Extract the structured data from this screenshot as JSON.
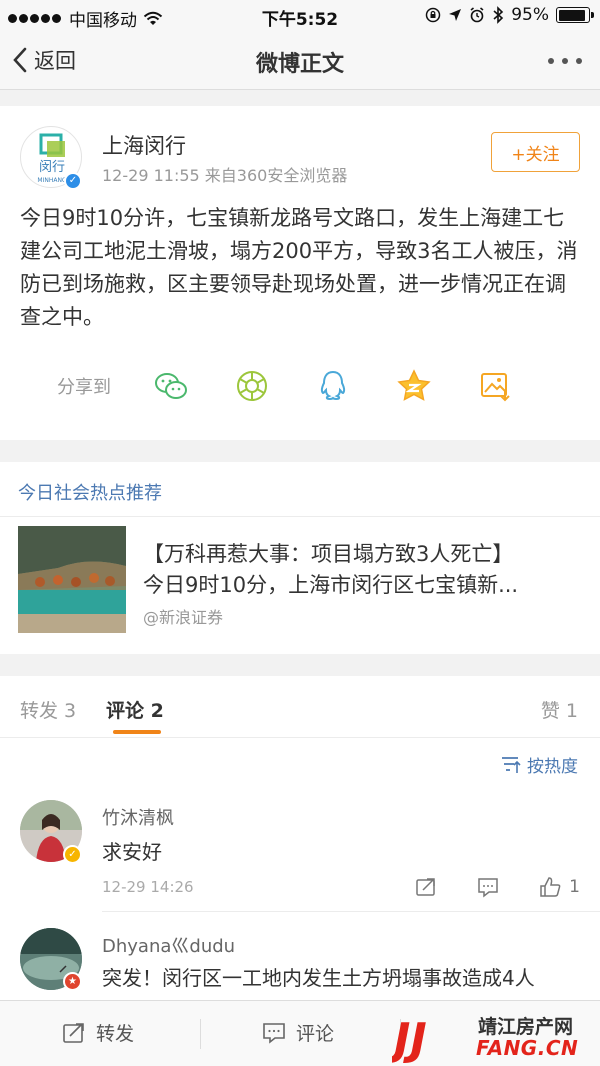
{
  "status_bar": {
    "carrier": "中国移动",
    "time": "下午5:52",
    "battery": "95%",
    "battery_level": 0.95
  },
  "nav": {
    "back_label": "返回",
    "title": "微博正文"
  },
  "post": {
    "avatar_text": "闵行",
    "avatar_subtext": "MINHANG",
    "username": "上海闵行",
    "meta": "12-29 11:55  来自360安全浏览器",
    "follow_label": "+关注",
    "text": "今日9时10分许，七宝镇新龙路号文路口，发生上海建工七建公司工地泥土滑坡，塌方200平方，导致3名工人被压，消防已到场施救，区主要领导赴现场处置，进一步情况正在调查之中。",
    "share_label": "分享到",
    "share_icons": [
      "wechat-icon",
      "moments-icon",
      "qq-icon",
      "qzone-icon",
      "save-image-icon"
    ]
  },
  "hot": {
    "heading": "今日社会热点推荐",
    "title_line1": "【万科再惹大事：项目塌方致3人死亡】",
    "title_line2": "今日9时10分，上海市闵行区七宝镇新...",
    "source": "@新浪证券"
  },
  "tabs": {
    "repost": "转发 3",
    "comment": "评论 2",
    "like": "赞 1"
  },
  "comments": {
    "sort_label": "按热度",
    "items": [
      {
        "name": "竹沐清枫",
        "text": "求安好",
        "time": "12-29 14:26",
        "likes": "1"
      },
      {
        "name": "Dhyana巛dudu",
        "text": "突发！闵行区一工地内发生土方坍塌事故造成4人"
      }
    ]
  },
  "bottom_bar": {
    "repost_label": "转发",
    "comment_label": "评论"
  },
  "watermark": {
    "logo": "JJ",
    "site_name": "靖江房产网",
    "url": "FANG.CN"
  },
  "colors": {
    "accent_orange": "#f08418",
    "link_blue": "#4c79b2",
    "verified_blue": "#2d8ee7",
    "watermark_red": "#e3241b"
  }
}
